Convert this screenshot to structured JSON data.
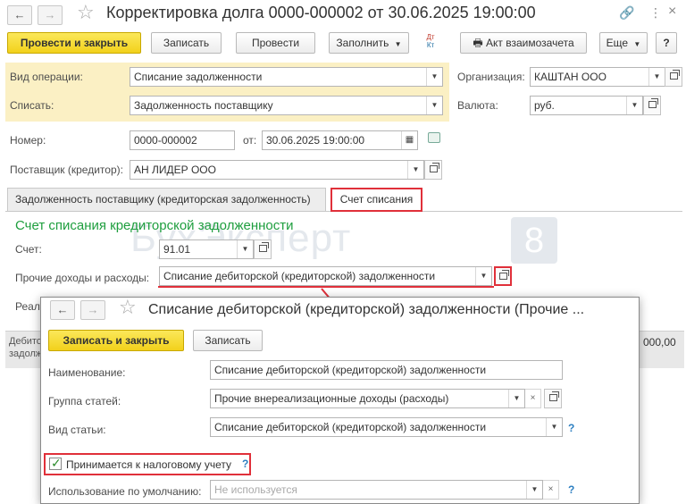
{
  "main": {
    "title": "Корректировка долга 0000-000002 от 30.06.2025 19:00:00",
    "toolbar": {
      "post_close": "Провести и закрыть",
      "save": "Записать",
      "post": "Провести",
      "fill": "Заполнить",
      "dt_kt_top": "Дт",
      "dt_kt_bottom": "Кт",
      "act": "Акт взаимозачета",
      "more": "Еще",
      "help": "?"
    },
    "fields": {
      "operation_label": "Вид операции:",
      "operation_value": "Списание задолженности",
      "writeoff_label": "Списать:",
      "writeoff_value": "Задолженность поставщику",
      "org_label": "Организация:",
      "org_value": "КАШТАН ООО",
      "currency_label": "Валюта:",
      "currency_value": "руб.",
      "number_label": "Номер:",
      "number_value": "0000-000002",
      "from_label": "от:",
      "date_value": "30.06.2025 19:00:00",
      "supplier_label": "Поставщик (кредитор):",
      "supplier_value": "АН ЛИДЕР ООО"
    },
    "tabs": [
      {
        "label": "Задолженность поставщику (кредиторская задолженность)"
      },
      {
        "label": "Счет списания"
      }
    ],
    "section": {
      "title": "Счет списания кредиторской задолженности",
      "account_label": "Счет:",
      "account_value": "91.01",
      "other_label": "Прочие доходы и расходы:",
      "other_value": "Списание дебиторской (кредиторской) задолженности",
      "partial_label": "Реал",
      "bottom_left_1": "Дебито",
      "bottom_left_2": "задолж",
      "bottom_right": "000,00"
    },
    "watermark": {
      "text": "БухЭксперт",
      "digit": "8"
    }
  },
  "dialog": {
    "title": "Списание дебиторской (кредиторской) задолженности (Прочие ...",
    "save_close": "Записать и закрыть",
    "save": "Записать",
    "name_label": "Наименование:",
    "name_value": "Списание дебиторской (кредиторской) задолженности",
    "group_label": "Группа статей:",
    "group_value": "Прочие внереализационные доходы (расходы)",
    "type_label": "Вид статьи:",
    "type_value": "Списание дебиторской (кредиторской) задолженности",
    "tax_label": "Принимается к налоговому учету",
    "tax_checked": true,
    "default_label": "Использование по умолчанию:",
    "default_placeholder": "Не используется",
    "help": "?"
  }
}
